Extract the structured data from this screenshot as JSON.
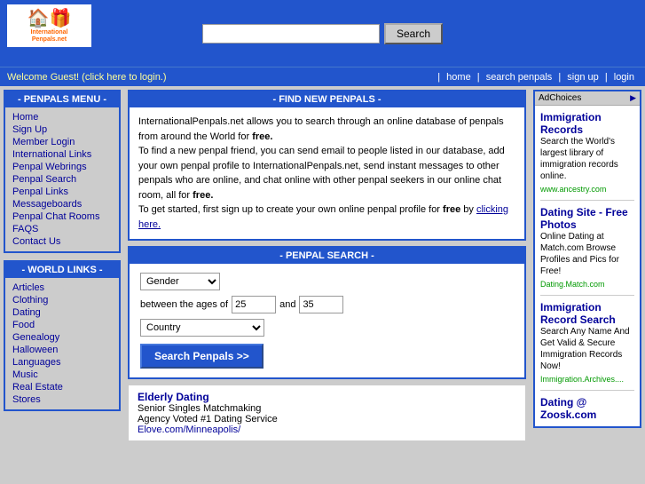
{
  "header": {
    "logo_text": "InternationalPenpals.net",
    "logo_icon": "🏠",
    "search_placeholder": "",
    "search_button": "Search"
  },
  "nav": {
    "welcome": "Welcome Guest! (click here to login.)",
    "links": [
      "home",
      "search penpals",
      "sign up",
      "login"
    ]
  },
  "sidebar": {
    "menu_title": "- PENPALS MENU -",
    "menu_links": [
      {
        "label": "Home",
        "href": "#"
      },
      {
        "label": "Sign Up",
        "href": "#"
      },
      {
        "label": "Member Login",
        "href": "#"
      },
      {
        "label": "International Links",
        "href": "#"
      },
      {
        "label": "Penpal Webrings",
        "href": "#"
      },
      {
        "label": "Penpal Search",
        "href": "#"
      },
      {
        "label": "Penpal Links",
        "href": "#"
      },
      {
        "label": "Messageboards",
        "href": "#"
      },
      {
        "label": "Penpal Chat Rooms",
        "href": "#"
      },
      {
        "label": "FAQS",
        "href": "#"
      },
      {
        "label": "Contact Us",
        "href": "#"
      }
    ],
    "world_title": "- WORLD LINKS -",
    "world_links": [
      {
        "label": "Articles",
        "href": "#"
      },
      {
        "label": "Clothing",
        "href": "#"
      },
      {
        "label": "Dating",
        "href": "#"
      },
      {
        "label": "Food",
        "href": "#"
      },
      {
        "label": "Genealogy",
        "href": "#"
      },
      {
        "label": "Halloween",
        "href": "#"
      },
      {
        "label": "Languages",
        "href": "#"
      },
      {
        "label": "Music",
        "href": "#"
      },
      {
        "label": "Real Estate",
        "href": "#"
      },
      {
        "label": "Stores",
        "href": "#"
      }
    ]
  },
  "main": {
    "find_title": "- FIND NEW PENPALS -",
    "find_p1": "InternationalPenpals.net allows you to search through an online database of penpals from around the World for free.",
    "find_p1_bold": "free.",
    "find_p2": "To find a new penpal friend, you can send email to people listed in our database, add your own penpal profile to InternationalPenpals.net, send instant messages to other penpals who are online, and chat online with other penpal seekers in our online chat room, all for free.",
    "find_p2_bold": "free.",
    "find_p3_start": "To get started, first sign up to create your own online penpal profile for ",
    "find_p3_bold": "free",
    "find_p3_end": " by",
    "find_p3_link": "clicking here.",
    "search_title": "- PENPAL SEARCH -",
    "gender_label": "Gender",
    "age_label_between": "between the ages of",
    "age_label_and": "and",
    "age_min": "25",
    "age_max": "35",
    "country_label": "Country",
    "search_button": "Search Penpals >>",
    "sponsor": {
      "title": "Elderly Dating",
      "subtitle": "Senior Singles Matchmaking",
      "desc": "Agency Voted #1 Dating Service",
      "link": "Elove.com/Minneapolis/"
    }
  },
  "right_ad": {
    "ad_choices": "AdChoices",
    "sections": [
      {
        "title": "Immigration",
        "title2": "Records",
        "body": "Search the World's largest library of immigration records online.",
        "url": "www.ancestry.com"
      },
      {
        "title": "Dating Site - Free Photos",
        "body": "Online Dating at Match.com Browse Profiles and Pics for Free!",
        "url": "Dating.Match.com"
      },
      {
        "title": "Immigration",
        "title2": "Record Search",
        "body": "Search Any Name And Get Valid & Secure Immigration Records Now!",
        "url": "Immigration.Archives...."
      },
      {
        "title": "Dating @",
        "title2": "Zoosk.com",
        "body": ""
      }
    ]
  }
}
